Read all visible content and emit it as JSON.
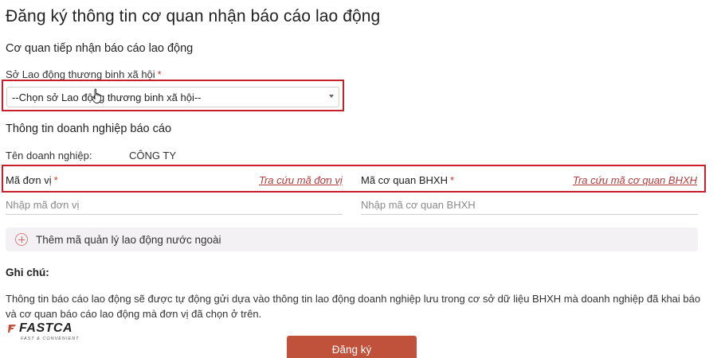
{
  "page": {
    "title": "Đăng ký thông tin cơ quan nhận báo cáo lao động"
  },
  "receiving_agency": {
    "section_title": "Cơ quan tiếp nhận báo cáo lao động",
    "field_label": "Sở Lao động thương binh xã hội",
    "required_mark": "*",
    "select_value": "--Chọn sở Lao động thương binh xã hội--"
  },
  "enterprise": {
    "section_title": "Thông tin doanh nghiệp báo cáo",
    "name_label": "Tên doanh nghiệp:",
    "name_value": "CÔNG TY",
    "unit_code_label": "Mã đơn vị",
    "unit_code_lookup": "Tra cứu mã đơn vị",
    "unit_code_placeholder": "Nhập mã đơn vị",
    "bhxh_code_label": "Mã cơ quan BHXH",
    "bhxh_code_lookup": "Tra cứu mã cơ quan BHXH",
    "bhxh_code_placeholder": "Nhập mã cơ quan BHXH",
    "required_mark": "*",
    "add_foreign_label": "Thêm mã quản lý lao động nước ngoài"
  },
  "note": {
    "heading": "Ghi chú:",
    "text": "Thông tin báo cáo lao động sẽ được tự động gửi dựa vào thông tin lao động doanh nghiệp lưu trong cơ sở dữ liệu BHXH mà doanh nghiệp đã khai báo và cơ quan báo cáo lao động mà đơn vị đã chọn ở trên."
  },
  "actions": {
    "submit_label": "Đăng ký"
  },
  "watermark": {
    "brand": "FASTCA",
    "tagline": "FAST & CONVENIENT"
  },
  "colors": {
    "highlight_border": "#c8202a",
    "link": "#b03a3a",
    "submit_bg": "#c0513a"
  }
}
